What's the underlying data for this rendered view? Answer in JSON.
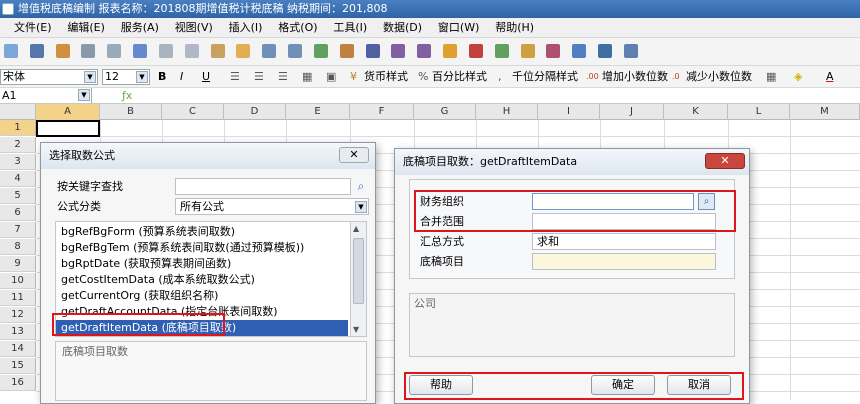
{
  "app": {
    "title": "增值税底稿编制 报表名称：201808期增值税计税底稿  纳税期间：201,808"
  },
  "menubar": [
    "文件(E)",
    "编辑(E)",
    "服务(A)",
    "视图(V)",
    "插入(I)",
    "格式(O)",
    "工具(I)",
    "数据(D)",
    "窗口(W)",
    "帮助(H)"
  ],
  "format_toolbar": {
    "font_name": "宋体",
    "font_size": "12",
    "bold": "B",
    "italic": "I",
    "underline": "U",
    "currency_style": "货币样式",
    "percent_style": "百分比样式",
    "thousands_sep": "千位分隔样式",
    "inc_decimal": "增加小数位数",
    "dec_decimal": "减少小数位数",
    "font_color_letter": "A"
  },
  "namebox": {
    "value": "A1"
  },
  "grid": {
    "columns": [
      "A",
      "B",
      "C",
      "D",
      "E",
      "F",
      "G",
      "H",
      "I",
      "J",
      "K",
      "L",
      "M"
    ],
    "rows": [
      "1",
      "2",
      "3",
      "4",
      "5",
      "6",
      "7",
      "8",
      "9",
      "10",
      "11",
      "12",
      "13",
      "14",
      "15",
      "16"
    ]
  },
  "formula_dialog": {
    "title": "选择取数公式",
    "keyword_label": "按关键字查找",
    "keyword_value": "",
    "category_label": "公式分类",
    "category_value": "所有公式",
    "items": [
      "bgRefBgForm (预算系统表间取数)",
      "bgRefBgTem (预算系统表间取数(通过预算模板))",
      "bgRptDate (获取预算表期间函数)",
      "getCostItemData (成本系统取数公式)",
      "getCurrentOrg (获取组织名称)",
      "getDraftAccountData (指定台账表间取数)",
      "getDraftItemData (底稿项目取数)"
    ],
    "selected_index": 6,
    "description": "底稿项目取数"
  },
  "param_dialog": {
    "title": "底稿项目取数：getDraftItemData",
    "fields": [
      {
        "label": "财务组织",
        "value": ""
      },
      {
        "label": "合并范围",
        "value": ""
      },
      {
        "label": "汇总方式",
        "value": "求和"
      },
      {
        "label": "底稿项目",
        "value": ""
      }
    ],
    "company_label": "公司",
    "help_button": "帮助",
    "ok_button": "确定",
    "cancel_button": "取消"
  },
  "colors": {
    "highlight_red": "#e0151b",
    "selection_blue": "#2f5fb3",
    "title_blue": "#3a6fb5"
  }
}
